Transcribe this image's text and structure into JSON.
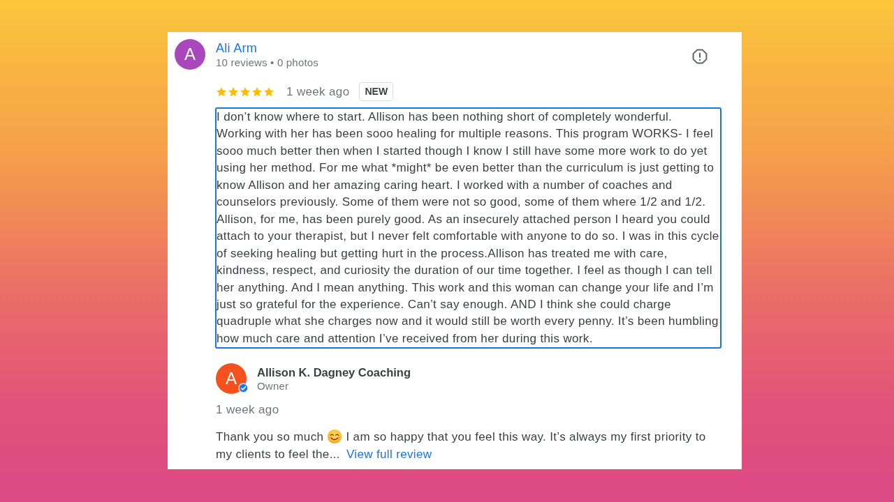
{
  "review": {
    "author": {
      "initial": "A",
      "name": "Ali Arm",
      "stats": "10 reviews • 0 photos"
    },
    "stars": 5,
    "time": "1 week ago",
    "badge": "NEW",
    "highlighted": true,
    "text": "I don’t know where to start. Allison has been nothing short of completely wonderful. Working with her has been sooo healing for multiple reasons. This program WORKS- I feel sooo much better then when I started though I know I still have some more work to do yet using her method. For me what *might* be even better than the curriculum is just getting to know Allison and her amazing caring heart. I worked with a number of coaches and counselors previously. Some of them were not so good, some of them where 1/2 and 1/2. Allison, for me, has been purely good. As an insecurely attached person I heard you could attach to your therapist, but I never felt comfortable with anyone to do so. I was in this cycle of seeking healing but getting hurt in the process.Allison has treated me with care, kindness, respect, and curiosity the duration of our time together. I feel as though I can tell her anything. And I mean anything. This work and this woman can change your life and I’m just so grateful for the experience. Can’t say enough. AND I think she could charge quadruple what she charges now and it would still be worth every penny. It’s been humbling how much care and attention I’ve received from her during this work."
  },
  "owner_response": {
    "initial": "A",
    "name": "Allison K. Dagney Coaching",
    "role": "Owner",
    "verified": true,
    "time": "1 week ago",
    "text_start": "Thank you so much",
    "text_end": "I am so happy that you feel this way. It’s always my first priority to my clients to feel the...",
    "link": "View full review"
  }
}
